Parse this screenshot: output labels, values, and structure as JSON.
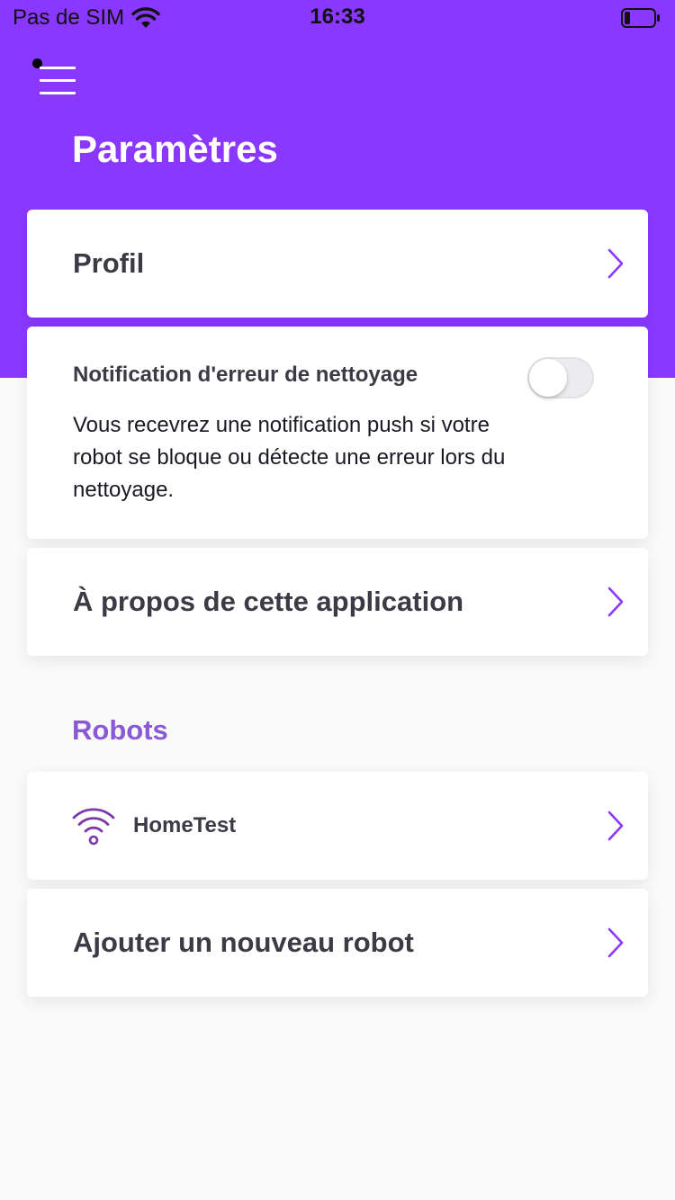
{
  "status_bar": {
    "carrier": "Pas de SIM",
    "time": "16:33"
  },
  "header": {
    "title": "Paramètres",
    "menu_icon": "hamburger-menu-icon"
  },
  "settings": {
    "profile_label": "Profil",
    "notification": {
      "title": "Notification d'erreur de nettoyage",
      "description": "Vous recevrez une notification push si votre robot se bloque ou détecte une erreur lors du nettoyage.",
      "enabled": false
    },
    "about_label": "À propos de cette application"
  },
  "robots": {
    "section_title": "Robots",
    "items": [
      {
        "name": "HomeTest",
        "icon": "wifi-icon"
      }
    ],
    "add_label": "Ajouter un nouveau robot"
  },
  "colors": {
    "accent": "#8a38ff",
    "section_title": "#8a5ad6",
    "chevron": "#8a38ff",
    "text": "#3b3a45"
  }
}
